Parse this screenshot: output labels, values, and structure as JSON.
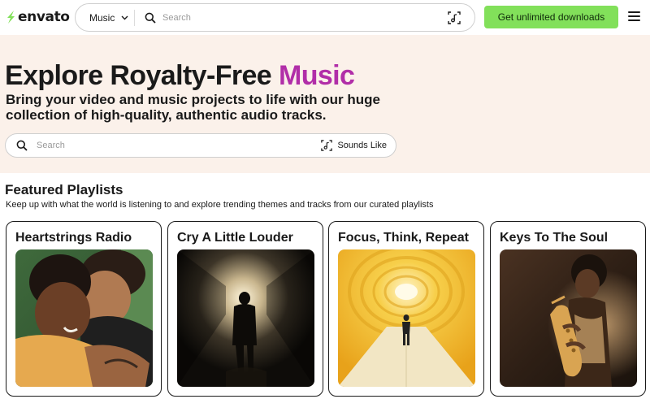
{
  "header": {
    "logo_text": "envato",
    "category": "Music",
    "search_placeholder": "Search",
    "cta_label": "Get unlimited downloads"
  },
  "hero": {
    "title_main": "Explore Royalty-Free ",
    "title_accent": "Music",
    "subtitle": "Bring your video and music projects to life with our huge collection of high-quality, authentic audio tracks.",
    "search_placeholder": "Search",
    "sounds_like_label": "Sounds Like"
  },
  "featured": {
    "title": "Featured Playlists",
    "subtitle": "Keep up with what the world is listening to and explore trending themes and tracks from our curated playlists",
    "playlists": [
      {
        "title": "Heartstrings Radio"
      },
      {
        "title": "Cry A Little Louder"
      },
      {
        "title": "Focus, Think, Repeat"
      },
      {
        "title": "Keys To The Soul"
      }
    ]
  },
  "colors": {
    "accent": "#b12ea8",
    "cta": "#82e05a",
    "hero_bg": "#fbf1ea"
  },
  "icons": [
    "envato-logo-icon",
    "chevron-down-icon",
    "search-icon",
    "audio-match-icon",
    "menu-icon"
  ]
}
